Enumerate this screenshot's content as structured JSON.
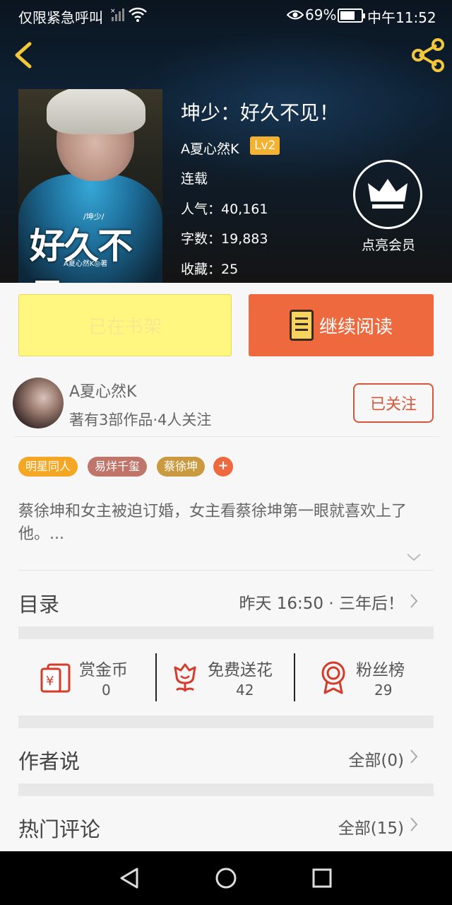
{
  "status_bar": {
    "carrier": "仅限紧急呼叫",
    "battery": "69%",
    "time": "中午11:52"
  },
  "book": {
    "title": "坤少：好久不见！",
    "author": "A夏心然K",
    "level": "Lv2",
    "status": "连载",
    "popularity": "人气：40,161",
    "word_count": "字数：19,883",
    "favorites": "收藏：25",
    "cover": {
      "series_tag": "/坤少/",
      "title": "好久不见",
      "author": "A夏心然K◎著"
    }
  },
  "vip": {
    "label": "点亮会员"
  },
  "actions": {
    "shelf_label": "已在书架",
    "read_label": "继续阅读"
  },
  "author": {
    "name": "A夏心然K",
    "meta": "著有3部作品·4人关注",
    "follow_label": "已关注"
  },
  "tags": [
    {
      "label": "明星同人",
      "color": "#f5a623"
    },
    {
      "label": "易烊千玺",
      "color": "#c0756a"
    },
    {
      "label": "蔡徐坤",
      "color": "#c99a3f"
    }
  ],
  "tag_add": "+",
  "description": "蔡徐坤和女主被迫订婚，女主看蔡徐坤第一眼就喜欢上了他。...",
  "catalog": {
    "label": "目录",
    "latest": "昨天 16:50 · 三年后！"
  },
  "stats": [
    {
      "label": "赏金币",
      "value": "0",
      "icon": "red-envelope-icon"
    },
    {
      "label": "免费送花",
      "value": "42",
      "icon": "flower-icon"
    },
    {
      "label": "粉丝榜",
      "value": "29",
      "icon": "medal-icon"
    }
  ],
  "author_says": {
    "label": "作者说",
    "all": "全部(0)"
  },
  "hot_comments": {
    "label": "热门评论",
    "all": "全部(15)"
  },
  "colors": {
    "accent": "#ee6a3e",
    "shelf_button": "#fff77f",
    "follow": "#d9553a",
    "icon_red": "#d63b2a"
  }
}
